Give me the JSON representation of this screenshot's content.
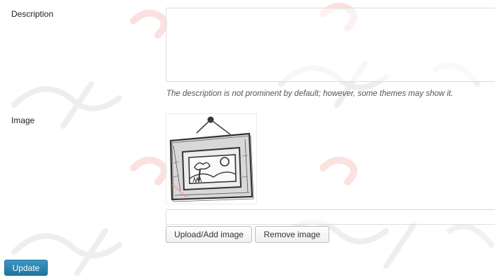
{
  "form": {
    "description": {
      "label": "Description",
      "value": "",
      "hint": "The description is not prominent by default; however, some themes may show it."
    },
    "image": {
      "label": "Image",
      "url_value": "",
      "preview_icon": "picture-frame-icon",
      "upload_button": "Upload/Add image",
      "remove_button": "Remove image"
    },
    "submit_button": "Update"
  },
  "colors": {
    "primary_button": "#21759b",
    "watermark": "#e84a3a"
  }
}
